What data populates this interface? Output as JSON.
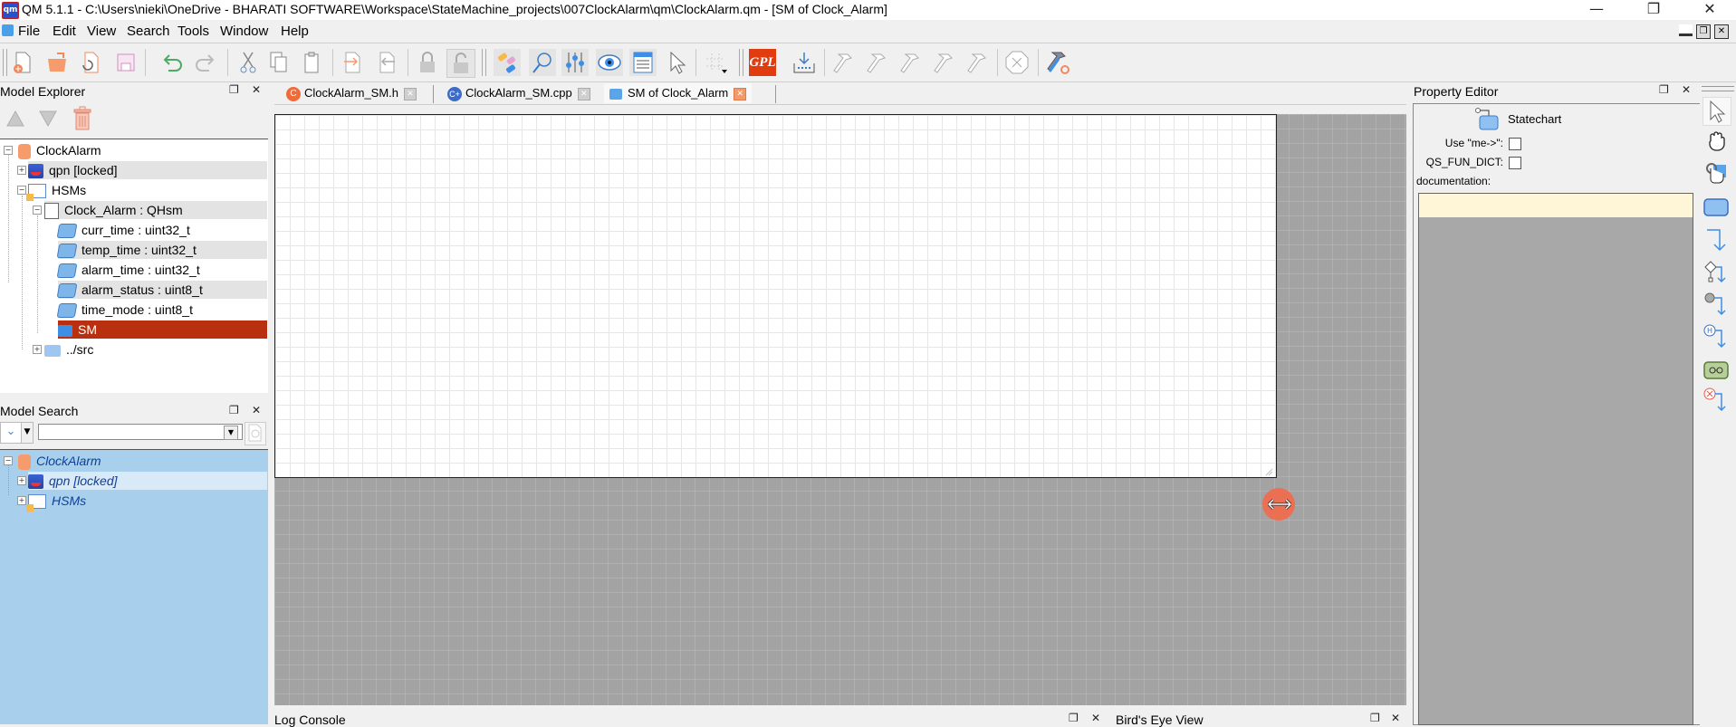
{
  "window": {
    "title": "QM 5.1.1 - C:\\Users\\nieki\\OneDrive - BHARATI SOFTWARE\\Workspace\\StateMachine_projects\\007ClockAlarm\\qm\\ClockAlarm.qm - [SM of Clock_Alarm]",
    "minimize": "—",
    "restore": "❐",
    "close": "✕"
  },
  "menu": [
    "File",
    "Edit",
    "View",
    "Search",
    "Tools",
    "Window",
    "Help"
  ],
  "toolbar": {
    "icons": [
      "new-model-icon",
      "open-model-icon",
      "reload-model-icon",
      "save-model-icon",
      "undo-icon",
      "redo-icon",
      "cut-icon",
      "copy-icon",
      "paste-icon",
      "import-icon",
      "export-icon",
      "lock-icon",
      "unlock-icon",
      "model-explorer-icon",
      "find-icon",
      "property-editor-icon",
      "view-icon",
      "log-console-icon",
      "select-icon",
      "grid-menu-icon",
      "gpl-license-icon",
      "generate-code-icon",
      "build-icon",
      "rebuild-icon",
      "clean-icon",
      "build-target-icon",
      "run-icon",
      "stop-icon",
      "manage-tools-icon"
    ],
    "gpl_label": "GPL"
  },
  "model_explorer": {
    "title": "Model Explorer",
    "tree": [
      {
        "label": "ClockAlarm",
        "icon": "model-icon",
        "level": 0,
        "expander": "−"
      },
      {
        "label": "qpn [locked]",
        "icon": "qpn-package-icon",
        "level": 1,
        "expander": "+",
        "highlight": true
      },
      {
        "label": "HSMs",
        "icon": "package-icon",
        "level": 1,
        "expander": "−"
      },
      {
        "label": "Clock_Alarm : QHsm",
        "icon": "class-icon",
        "level": 2,
        "expander": "−",
        "highlight": true
      },
      {
        "label": "curr_time : uint32_t",
        "icon": "attribute-icon",
        "level": 3
      },
      {
        "label": "temp_time : uint32_t",
        "icon": "attribute-icon",
        "level": 3,
        "highlight": true
      },
      {
        "label": "alarm_time : uint32_t",
        "icon": "attribute-icon",
        "level": 3
      },
      {
        "label": "alarm_status : uint8_t",
        "icon": "attribute-icon",
        "level": 3,
        "highlight": true
      },
      {
        "label": "time_mode : uint8_t",
        "icon": "attribute-icon",
        "level": 3
      },
      {
        "label": "SM",
        "icon": "state-machine-icon",
        "level": 3,
        "selected": true
      },
      {
        "label": "../src",
        "icon": "directory-icon",
        "level": 2,
        "expander": "+"
      }
    ]
  },
  "model_search": {
    "title": "Model Search",
    "query": "",
    "tree": [
      {
        "label": "ClockAlarm",
        "level": 0,
        "expander": "−"
      },
      {
        "label": "qpn [locked]",
        "level": 1,
        "expander": "+",
        "highlight": true
      },
      {
        "label": "HSMs",
        "level": 1,
        "expander": "+"
      }
    ]
  },
  "tabs": [
    {
      "label": "ClockAlarm_SM.h",
      "icon": "c-file-icon",
      "active": false
    },
    {
      "label": "ClockAlarm_SM.cpp",
      "icon": "cpp-file-icon",
      "active": false
    },
    {
      "label": "SM of Clock_Alarm",
      "icon": "statechart-icon",
      "active": true
    }
  ],
  "property_editor": {
    "title": "Property Editor",
    "element_type": "Statechart",
    "use_me_label": "Use \"me->\":",
    "use_me_checked": false,
    "qs_fun_dict_label": "QS_FUN_DICT:",
    "qs_fun_dict_checked": false,
    "documentation_label": "documentation:",
    "documentation": ""
  },
  "palette": [
    "select-tool-icon",
    "pan-tool-icon",
    "touch-tool-icon",
    "state-tool-icon",
    "transition-tool-icon",
    "choice-tool-icon",
    "initial-transition-tool-icon",
    "history-tool-icon",
    "submachine-tool-icon",
    "terminate-tool-icon"
  ],
  "bottom": {
    "log_console_title": "Log Console",
    "birds_eye_title": "Bird's Eye View"
  }
}
